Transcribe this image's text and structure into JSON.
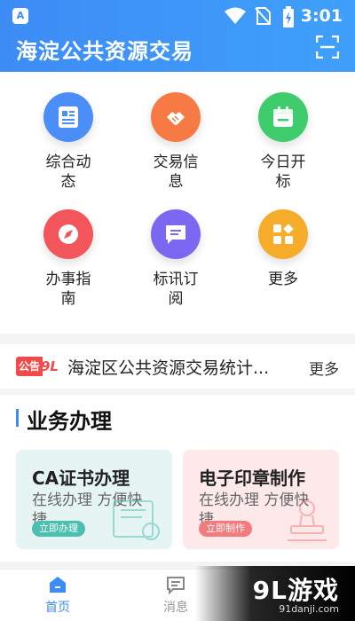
{
  "status_bar": {
    "time": "3:01",
    "app_icon_letter": "A"
  },
  "header": {
    "title": "海淀公共资源交易",
    "scan_icon": "scan-icon"
  },
  "grid": [
    {
      "label": "综合动态",
      "icon": "document-icon",
      "color": "#4c8ef7"
    },
    {
      "label": "交易信息",
      "icon": "handshake-icon",
      "color": "#f77a45"
    },
    {
      "label": "今日开标",
      "icon": "calendar-icon",
      "color": "#3fcc6c"
    },
    {
      "label": "办事指南",
      "icon": "compass-icon",
      "color": "#f2555a"
    },
    {
      "label": "标讯订阅",
      "icon": "message-icon",
      "color": "#7a68f2"
    },
    {
      "label": "更多",
      "icon": "apps-icon",
      "color": "#f6ad2b"
    }
  ],
  "news": {
    "badge_left": "公告",
    "badge_right": "9L",
    "text": "海淀区公共资源交易统计...",
    "more": "更多"
  },
  "business": {
    "section_title": "业务办理",
    "cards": [
      {
        "title": "CA证书办理",
        "desc": "在线办理 方便快捷",
        "button": "立即办理",
        "bg": "#e6f5f3",
        "accent": "#49c0b0"
      },
      {
        "title": "电子印章制作",
        "desc": "在线办理 方便快捷",
        "button": "立即制作",
        "bg": "#fde9e9",
        "accent": "#f47b7b"
      }
    ]
  },
  "nav": [
    {
      "label": "首页",
      "icon": "home-icon",
      "active": true
    },
    {
      "label": "消息",
      "icon": "message-icon",
      "active": false
    }
  ],
  "watermark": {
    "big": "9L游戏",
    "small": "91danji.com"
  }
}
